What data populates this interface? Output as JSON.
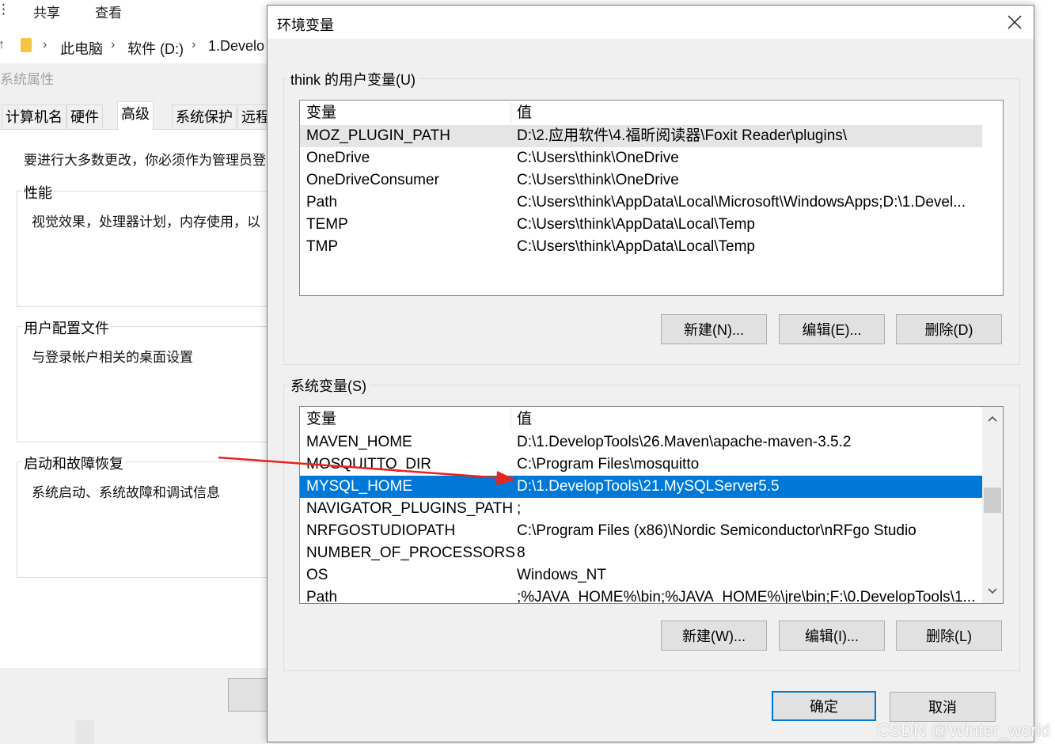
{
  "explorer": {
    "ribbon_tabs": [
      "共享",
      "查看"
    ],
    "breadcrumb": [
      "此电脑",
      "软件 (D:)",
      "1.Develo"
    ]
  },
  "system_properties": {
    "title": "系统属性",
    "tabs": [
      "计算机名",
      "硬件",
      "高级",
      "系统保护",
      "远程"
    ],
    "active_tab": "高级",
    "admin_note": "要进行大多数更改，你必须作为管理员登",
    "groups": [
      {
        "title": "性能",
        "desc": "视觉效果，处理器计划，内存使用，以"
      },
      {
        "title": "用户配置文件",
        "desc": "与登录帐户相关的桌面设置"
      },
      {
        "title": "启动和故障恢复",
        "desc": "系统启动、系统故障和调试信息"
      }
    ]
  },
  "dialog": {
    "title": "环境变量",
    "user_vars": {
      "label": "think 的用户变量(U)",
      "header": {
        "name": "变量",
        "value": "值"
      },
      "rows": [
        {
          "name": "MOZ_PLUGIN_PATH",
          "value": "D:\\2.应用软件\\4.福昕阅读器\\Foxit Reader\\plugins\\"
        },
        {
          "name": "OneDrive",
          "value": "C:\\Users\\think\\OneDrive"
        },
        {
          "name": "OneDriveConsumer",
          "value": "C:\\Users\\think\\OneDrive"
        },
        {
          "name": "Path",
          "value": "C:\\Users\\think\\AppData\\Local\\Microsoft\\WindowsApps;D:\\1.Devel..."
        },
        {
          "name": "TEMP",
          "value": "C:\\Users\\think\\AppData\\Local\\Temp"
        },
        {
          "name": "TMP",
          "value": "C:\\Users\\think\\AppData\\Local\\Temp"
        }
      ],
      "buttons": {
        "new": "新建(N)...",
        "edit": "编辑(E)...",
        "delete": "删除(D)"
      }
    },
    "system_vars": {
      "label": "系统变量(S)",
      "header": {
        "name": "变量",
        "value": "值"
      },
      "rows": [
        {
          "name": "MAVEN_HOME",
          "value": "D:\\1.DevelopTools\\26.Maven\\apache-maven-3.5.2"
        },
        {
          "name": "MOSQUITTO_DIR",
          "value": "C:\\Program Files\\mosquitto"
        },
        {
          "name": "MYSQL_HOME",
          "value": "D:\\1.DevelopTools\\21.MySQLServer5.5"
        },
        {
          "name": "NAVIGATOR_PLUGINS_PATH",
          "value": ";"
        },
        {
          "name": "NRFGOSTUDIOPATH",
          "value": "C:\\Program Files (x86)\\Nordic Semiconductor\\nRFgo Studio"
        },
        {
          "name": "NUMBER_OF_PROCESSORS",
          "value": "8"
        },
        {
          "name": "OS",
          "value": "Windows_NT"
        },
        {
          "name": "Path",
          "value": ";%JAVA_HOME%\\bin;%JAVA_HOME%\\jre\\bin;F:\\0.DevelopTools\\1..."
        }
      ],
      "selected_row": "MYSQL_HOME",
      "buttons": {
        "new": "新建(W)...",
        "edit": "编辑(I)...",
        "delete": "删除(L)"
      }
    },
    "ok": "确定",
    "cancel": "取消"
  },
  "watermark": "CSDN @Winter_world",
  "colors": {
    "selection": "#0078d7",
    "annotation_arrow": "#e8231f",
    "dialog_bg": "#f0f0f0"
  }
}
